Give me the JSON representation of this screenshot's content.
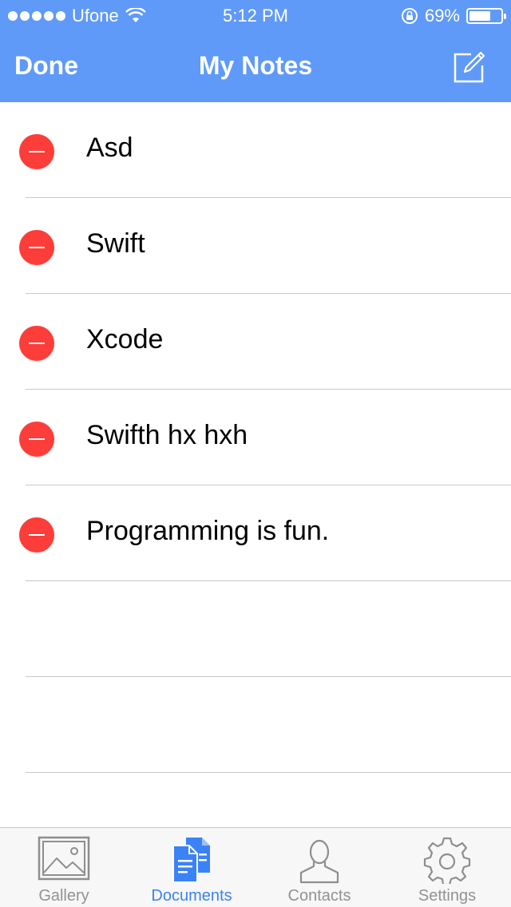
{
  "status_bar": {
    "carrier": "Ufone",
    "time": "5:12 PM",
    "battery": "69%",
    "battery_level": 0.69
  },
  "nav": {
    "left_button": "Done",
    "title": "My Notes",
    "right_icon": "compose-icon"
  },
  "notes": [
    {
      "title": "Asd"
    },
    {
      "title": "Swift"
    },
    {
      "title": "Xcode"
    },
    {
      "title": "Swifth hx hxh"
    },
    {
      "title": "Programming is fun."
    }
  ],
  "tabs": [
    {
      "label": "Gallery",
      "icon": "gallery-icon",
      "active": false
    },
    {
      "label": "Documents",
      "icon": "documents-icon",
      "active": true
    },
    {
      "label": "Contacts",
      "icon": "contacts-icon",
      "active": false
    },
    {
      "label": "Settings",
      "icon": "settings-icon",
      "active": false
    }
  ],
  "colors": {
    "header": "#5f9af9",
    "delete": "#fc3d39",
    "tab_active": "#3b82f6",
    "tab_inactive": "#929292"
  }
}
